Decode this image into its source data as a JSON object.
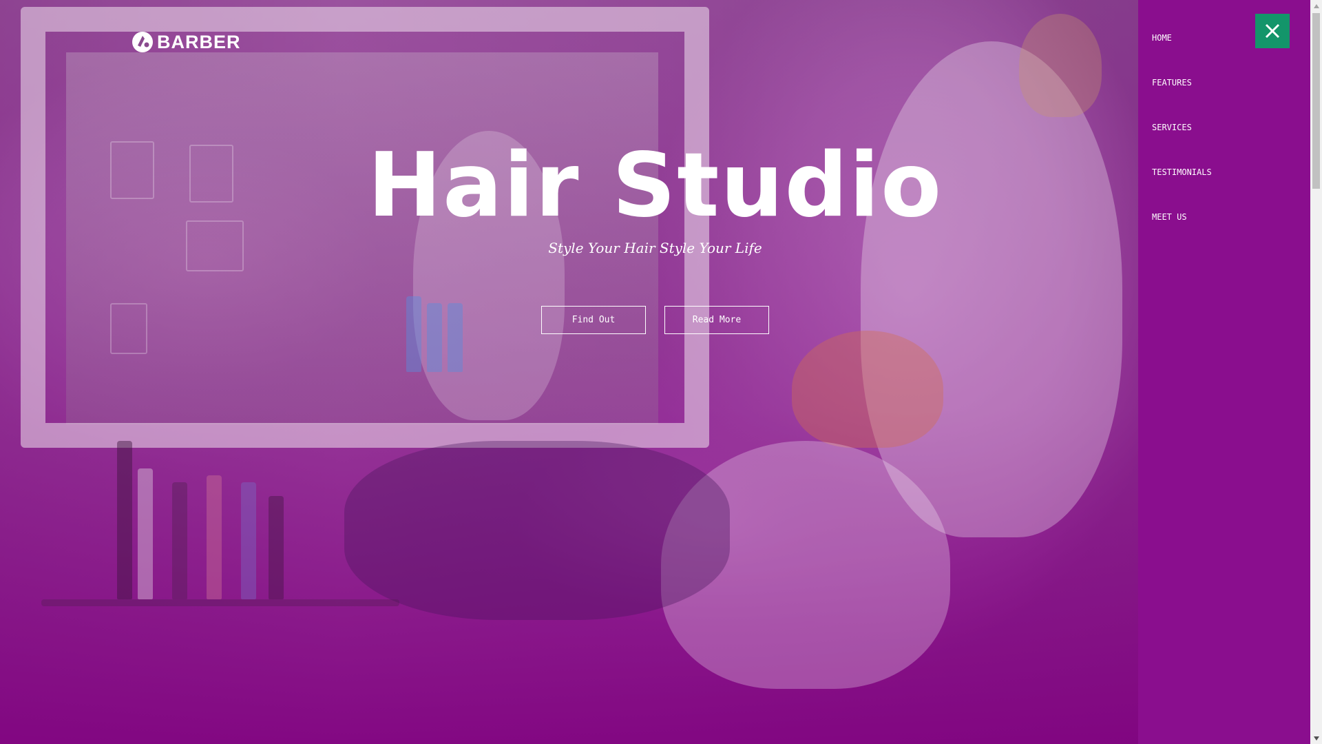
{
  "brand": {
    "logo_text": "BARBER",
    "logo_icon": "barber-logo-icon"
  },
  "hero": {
    "title": "Hair Studio",
    "subtitle": "Style Your Hair Style Your Life",
    "buttons": {
      "find_out": "Find Out",
      "read_more": "Read More"
    }
  },
  "side_menu": {
    "items": [
      "HOME",
      "FEATURES",
      "SERVICES",
      "TESTIMONIALS",
      "MEET US"
    ],
    "close_icon": "close-icon"
  },
  "colors": {
    "overlay": "#8a0e8e",
    "menu_background": "#8a0e8e",
    "close_button": "#13956a",
    "text": "#ffffff"
  }
}
